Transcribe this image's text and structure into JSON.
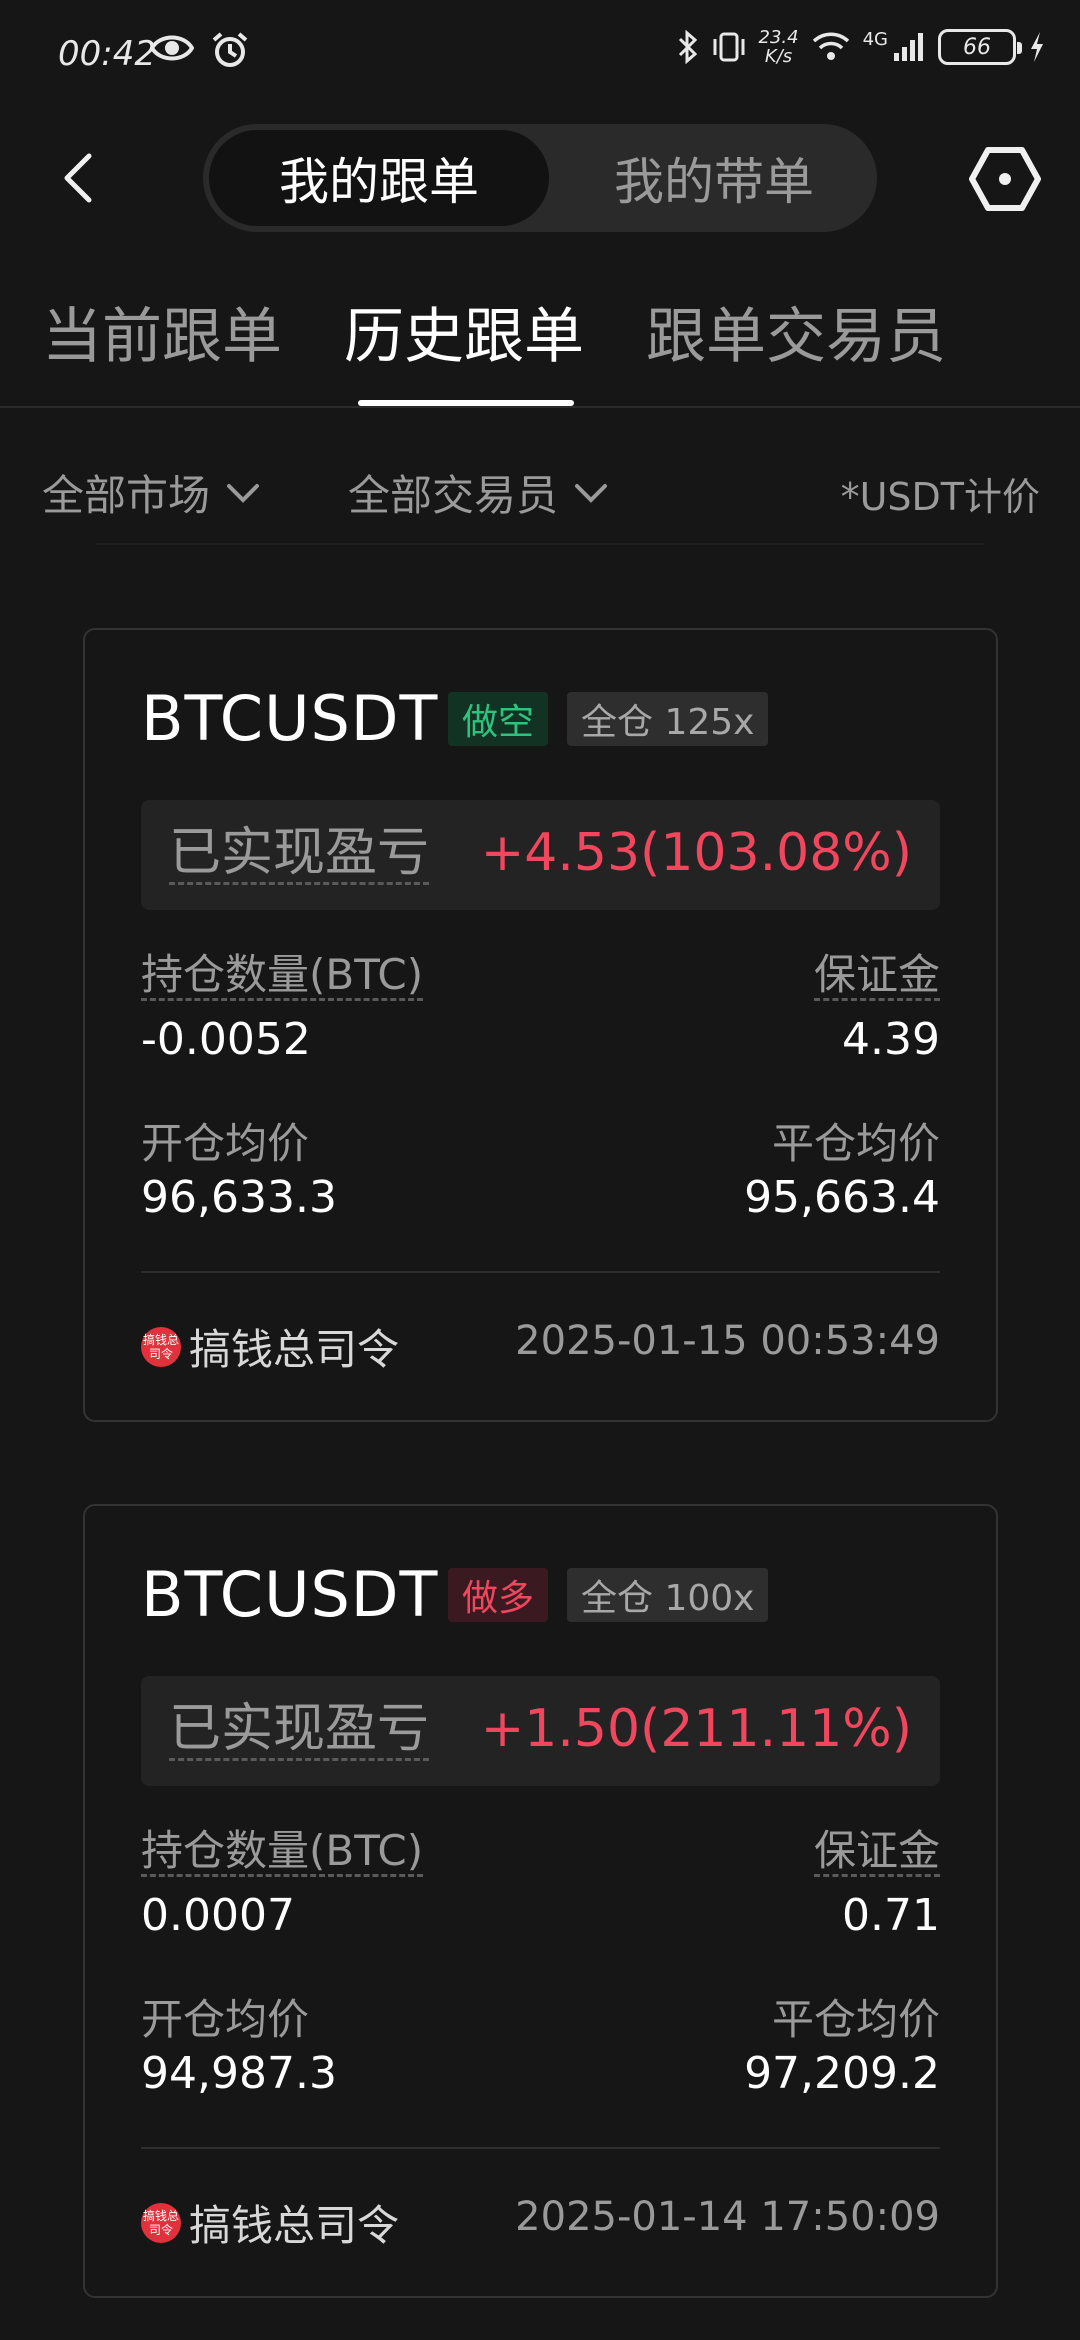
{
  "status_bar": {
    "time": "00:42",
    "net_speed_value": "23.4",
    "net_speed_unit": "K/s",
    "network": "4G",
    "battery": "66"
  },
  "header": {
    "segments": [
      "我的跟单",
      "我的带单"
    ]
  },
  "tabs": [
    "当前跟单",
    "历史跟单",
    "跟单交易员"
  ],
  "filters": {
    "market": "全部市场",
    "trader": "全部交易员",
    "unit_note": "*USDT计价"
  },
  "orders": [
    {
      "symbol": "BTCUSDT",
      "side": "做空",
      "mode": "全仓 125x",
      "pnl_label": "已实现盈亏",
      "pnl_value": "+4.53(103.08%)",
      "qty_label": "持仓数量(BTC)",
      "qty_value": "-0.0052",
      "margin_label": "保证金",
      "margin_value": "4.39",
      "open_label": "开仓均价",
      "open_value": "96,633.3",
      "close_label": "平仓均价",
      "close_value": "95,663.4",
      "trader_avatar_text": "搞钱总司令",
      "trader_name": "搞钱总司令",
      "time": "2025-01-15 00:53:49"
    },
    {
      "symbol": "BTCUSDT",
      "side": "做多",
      "mode": "全仓 100x",
      "pnl_label": "已实现盈亏",
      "pnl_value": "+1.50(211.11%)",
      "qty_label": "持仓数量(BTC)",
      "qty_value": "0.0007",
      "margin_label": "保证金",
      "margin_value": "0.71",
      "open_label": "开仓均价",
      "open_value": "94,987.3",
      "close_label": "平仓均价",
      "close_value": "97,209.2",
      "trader_avatar_text": "搞钱总司令",
      "trader_name": "搞钱总司令",
      "time": "2025-01-14 17:50:09"
    }
  ],
  "colors": {
    "background": "#161616",
    "profit": "#f0475e",
    "short_tag": "#2ec27e",
    "long_tag": "#f0475e"
  }
}
